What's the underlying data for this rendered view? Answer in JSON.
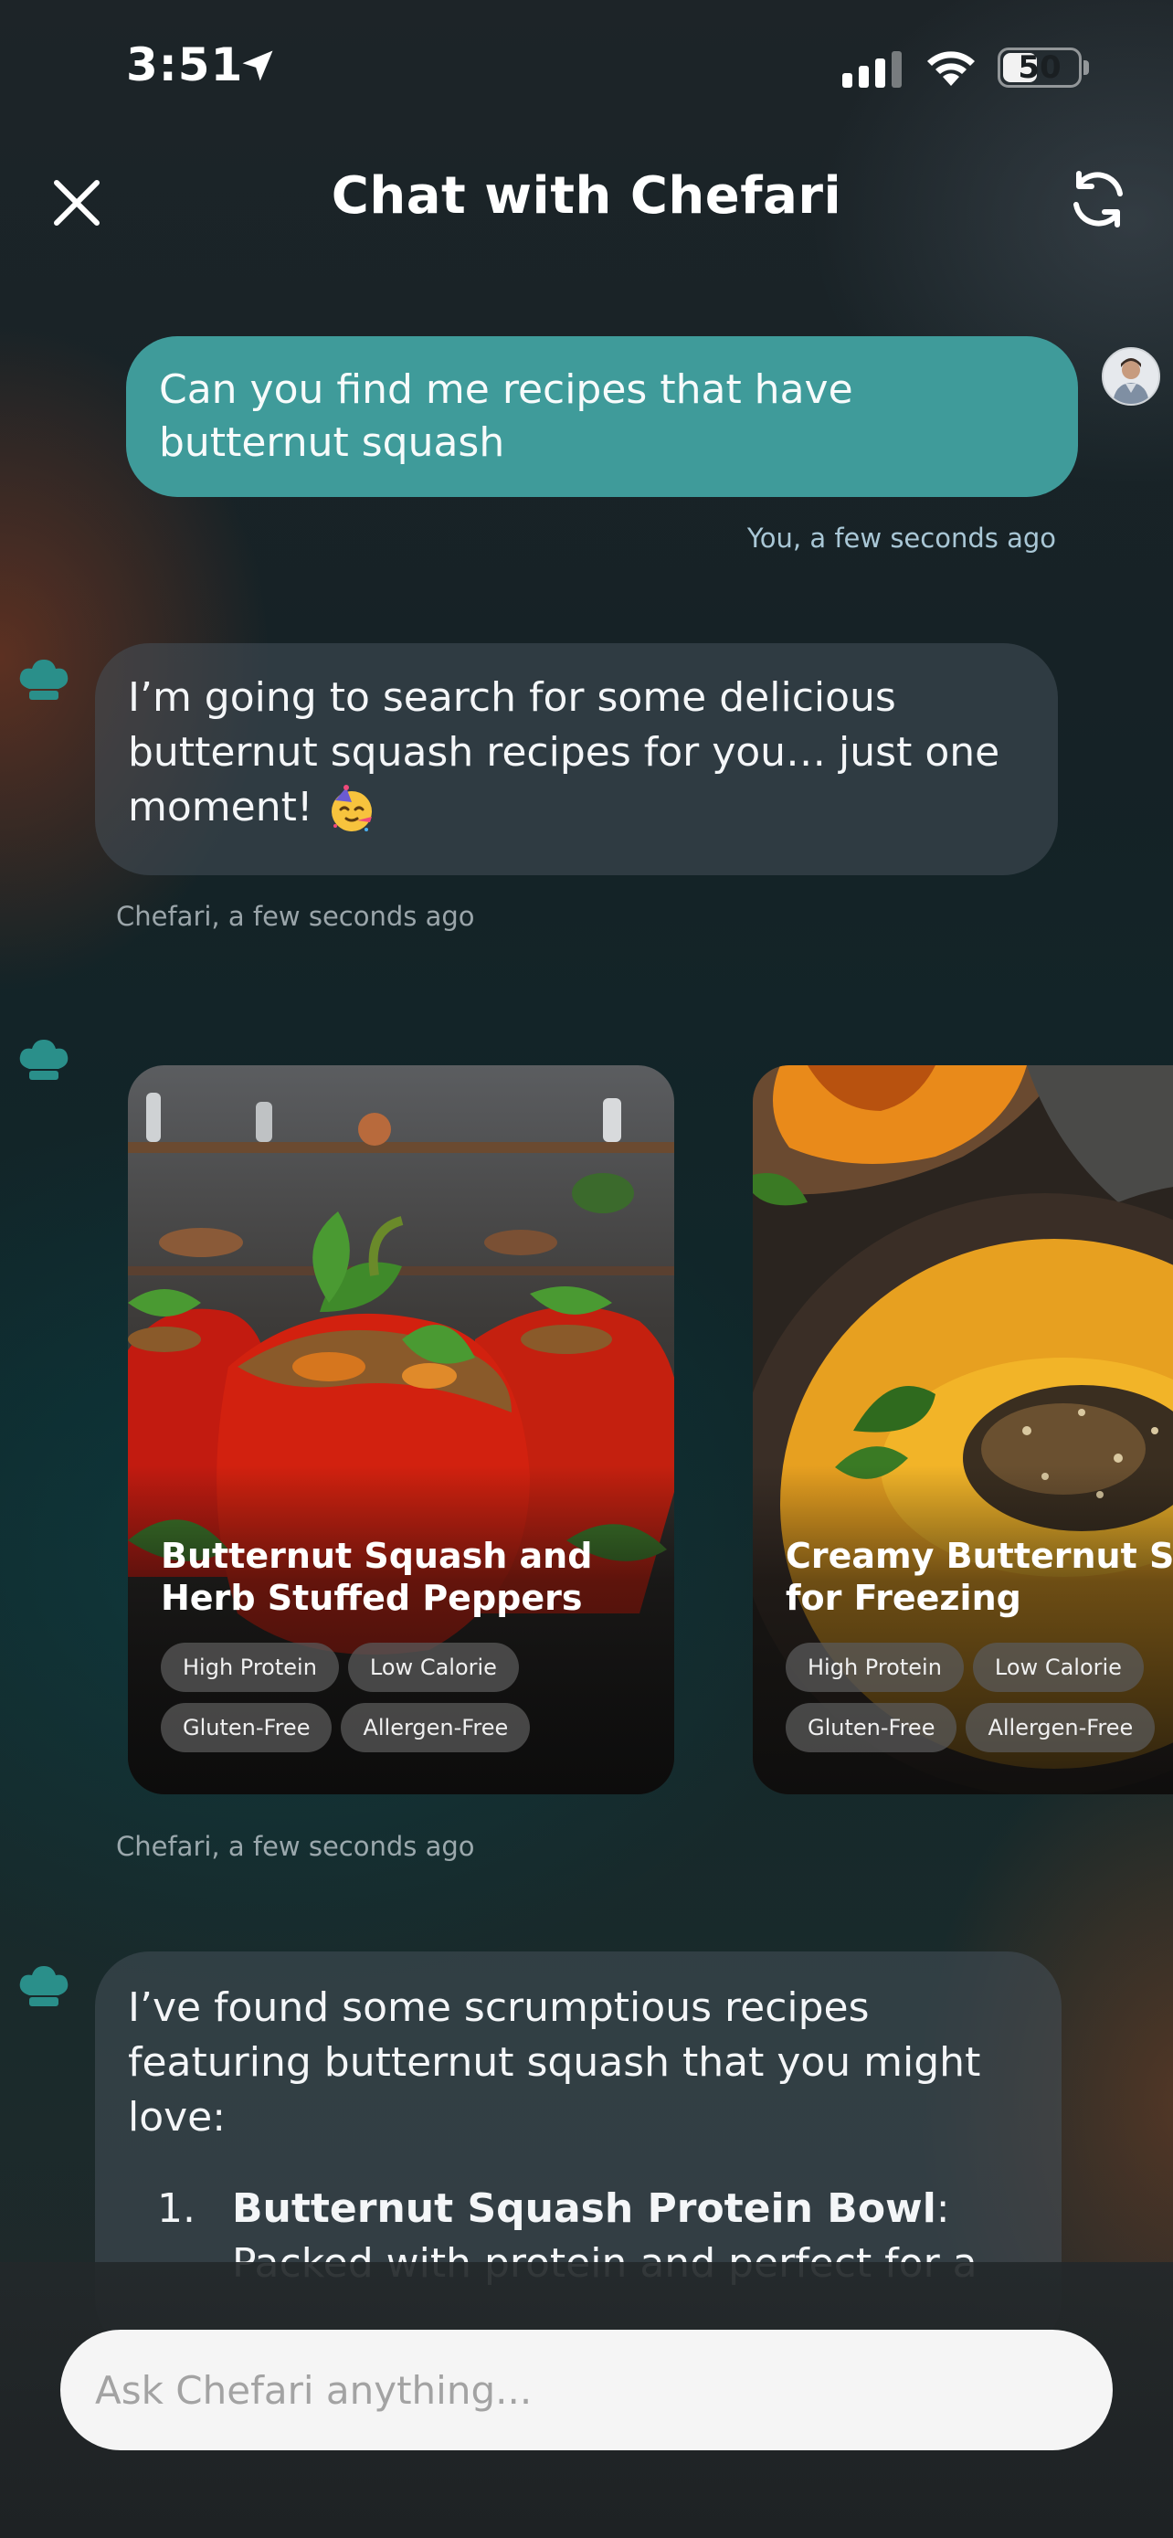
{
  "status_bar": {
    "time": "3:51",
    "battery": "50",
    "battery_level": 0.5
  },
  "header": {
    "title": "Chat with Chefari",
    "close_icon": "close-icon",
    "refresh_icon": "refresh-icon"
  },
  "messages": {
    "user": {
      "text": "Can you find me recipes that have butternut squash",
      "meta": "You, a few seconds ago"
    },
    "bot1": {
      "text": "I’m going to search for some delicious butternut squash recipes for you… just one moment!",
      "emoji": "🥳",
      "meta": "Chefari, a few seconds ago"
    },
    "cards_meta": "Chefari, a few seconds ago",
    "bot2": {
      "intro": "I’ve found some scrumptious recipes featuring butternut squash that you might love:",
      "list_number": "1.",
      "list_title": "Butternut Squash Protein Bowl",
      "list_after_title": ":",
      "list_rest": "Packed with protein and perfect for a"
    }
  },
  "recipes": [
    {
      "title": "Butternut Squash and Herb Stuffed Peppers",
      "tags": [
        "High Protein",
        "Low Calorie",
        "Gluten-Free",
        "Allergen-Free"
      ]
    },
    {
      "title": "Creamy Butternut Squash Soup for Freezing",
      "tags": [
        "High Protein",
        "Low Calorie",
        "Gluten-Free",
        "Allergen-Free"
      ]
    }
  ],
  "composer": {
    "placeholder": "Ask Chefari anything..."
  },
  "colors": {
    "user_bubble": "#3f9b9a",
    "accent": "#2a8f8a"
  }
}
